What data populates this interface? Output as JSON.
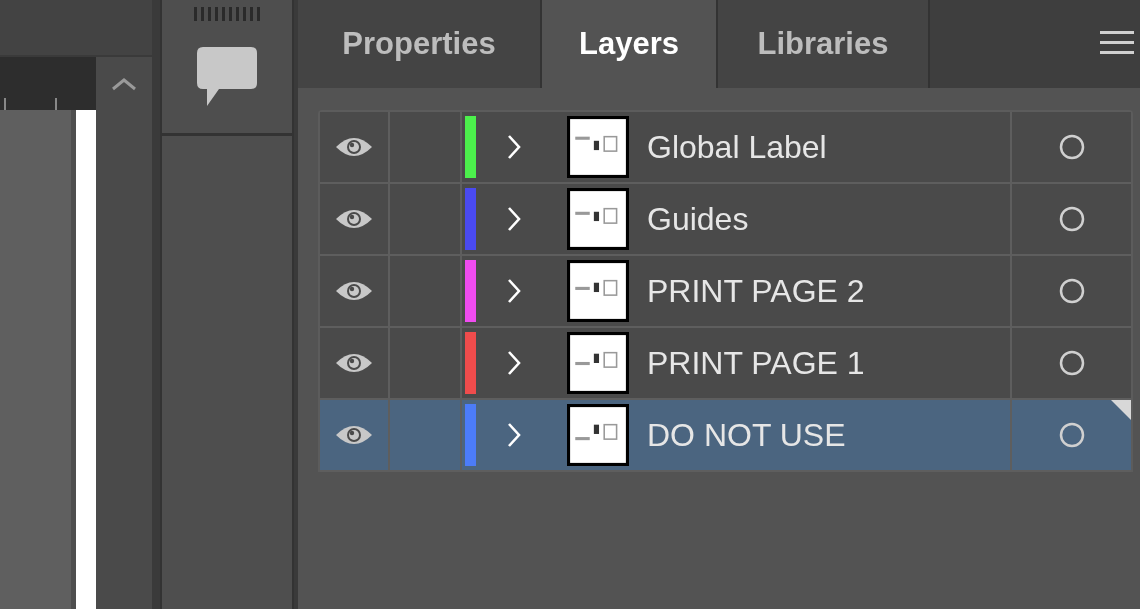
{
  "panel": {
    "tabs": [
      {
        "label": "Properties",
        "selected": false
      },
      {
        "label": "Layers",
        "selected": true
      },
      {
        "label": "Libraries",
        "selected": false
      }
    ]
  },
  "layers": [
    {
      "name": "Global Label",
      "color": "#4cf04c",
      "visible": true,
      "selected": false
    },
    {
      "name": "Guides",
      "color": "#4a4af0",
      "visible": true,
      "selected": false
    },
    {
      "name": "PRINT PAGE 2",
      "color": "#f04cf0",
      "visible": true,
      "selected": false
    },
    {
      "name": "PRINT PAGE 1",
      "color": "#f04c4c",
      "visible": true,
      "selected": false
    },
    {
      "name": "DO NOT USE",
      "color": "#4c7cf8",
      "visible": true,
      "selected": true
    }
  ]
}
